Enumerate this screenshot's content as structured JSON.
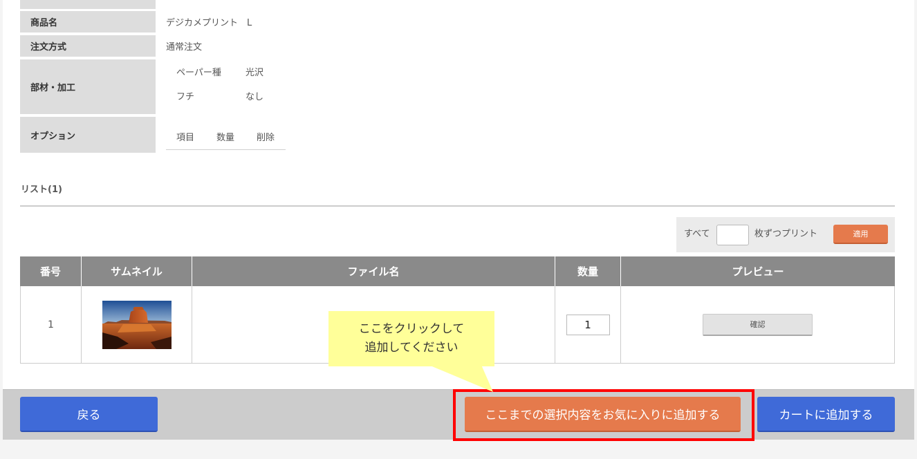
{
  "info_rows": {
    "product": {
      "label": "商品名",
      "value": "デジカメプリント　L"
    },
    "order_type": {
      "label": "注文方式",
      "value": "通常注文"
    },
    "materials": {
      "label": "部材・加工",
      "items": [
        {
          "name": "ペーパー種",
          "value": "光沢"
        },
        {
          "name": "フチ",
          "value": "なし"
        }
      ]
    },
    "options": {
      "label": "オプション",
      "headers": [
        "項目",
        "数量",
        "削除"
      ]
    }
  },
  "list": {
    "title": "リスト(1)"
  },
  "bulk": {
    "prefix": "すべて",
    "input_value": "",
    "suffix": "枚ずつプリント",
    "apply_label": "適用"
  },
  "table": {
    "headers": [
      "番号",
      "サムネイル",
      "ファイル名",
      "数量",
      "プレビュー"
    ],
    "rows": [
      {
        "number": "1",
        "quantity": "1",
        "preview_label": "確認"
      }
    ]
  },
  "tooltip": {
    "line1": "ここをクリックして",
    "line2": "追加してください"
  },
  "footer": {
    "back_label": "戻る",
    "favorite_label": "ここまでの選択内容をお気に入りに追加する",
    "cart_label": "カートに追加する"
  },
  "colors": {
    "primary": "#3f6ad8",
    "accent": "#e57a4c",
    "highlight": "#ff0000",
    "tooltip": "#ffff99"
  }
}
